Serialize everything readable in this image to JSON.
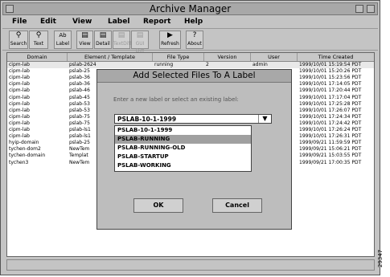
{
  "window": {
    "title": "Archive Manager"
  },
  "menu": [
    "File",
    "Edit",
    "View",
    "Label",
    "Report",
    "Help"
  ],
  "toolbar": [
    {
      "label": "Search",
      "icon": "search-icon",
      "enabled": true
    },
    {
      "label": "Text",
      "icon": "text-search-icon",
      "enabled": true
    },
    {
      "label": "Label",
      "icon": "label-icon",
      "enabled": true
    },
    {
      "label": "View",
      "icon": "view-icon",
      "enabled": true
    },
    {
      "label": "Detail",
      "icon": "detail-icon",
      "enabled": true
    },
    {
      "label": "TextDiff",
      "icon": "text-diff-icon",
      "enabled": false
    },
    {
      "label": "GUI Diff",
      "icon": "gui-diff-icon",
      "enabled": false
    },
    {
      "label": "Refresh",
      "icon": "refresh-icon",
      "enabled": true
    },
    {
      "label": "About",
      "icon": "about-icon",
      "enabled": true
    }
  ],
  "table": {
    "columns": [
      "Domain",
      "Element / Template",
      "File Type",
      "Version",
      "User",
      "Time Created"
    ],
    "rows": [
      [
        "cipm-lab",
        "pslab-2624",
        "running",
        "2",
        "admin",
        "1999/10/01 15:19:54 PDT"
      ],
      [
        "cipm-lab",
        "pslab-25",
        "",
        "",
        "",
        "1999/10/01 15:20:26 PDT"
      ],
      [
        "cipm-lab",
        "pslab-36",
        "",
        "",
        "",
        "1999/10/01 15:23:56 PDT"
      ],
      [
        "cipm-lab",
        "pslab-36",
        "",
        "",
        "",
        "1999/10/01 17:14:05 PDT"
      ],
      [
        "cipm-lab",
        "pslab-46",
        "",
        "",
        "",
        "1999/10/01 17:20:44 PDT"
      ],
      [
        "cipm-lab",
        "pslab-45",
        "",
        "",
        "",
        "1999/10/01 17:17:04 PDT"
      ],
      [
        "cipm-lab",
        "pslab-53",
        "",
        "",
        "",
        "1999/10/01 17:25:28 PDT"
      ],
      [
        "cipm-lab",
        "pslab-53",
        "",
        "",
        "",
        "1999/10/01 17:26:07 PDT"
      ],
      [
        "cipm-lab",
        "pslab-75",
        "",
        "",
        "",
        "1999/10/01 17:24:34 PDT"
      ],
      [
        "cipm-lab",
        "pslab-75",
        "",
        "",
        "",
        "1999/10/01 17:24:42 PDT"
      ],
      [
        "cipm-lab",
        "pslab-ls1",
        "",
        "",
        "",
        "1999/10/01 17:26:24 PDT"
      ],
      [
        "cipm-lab",
        "pslab-ls1",
        "",
        "",
        "",
        "1999/10/01 17:26:31 PDT"
      ],
      [
        "hyip-domain",
        "pslab-25",
        "",
        "",
        "",
        "1999/09/21 11:59:59 PDT"
      ],
      [
        "tychen-dom2",
        "NewTem",
        "",
        "",
        "",
        "1999/09/21 15:06:21 PDT"
      ],
      [
        "tychen-domain",
        "Templat",
        "",
        "",
        "",
        "1999/09/21 15:03:55 PDT"
      ],
      [
        "tychen3",
        "NewTem",
        "",
        "",
        "",
        "1999/09/21 17:00:35 PDT"
      ]
    ]
  },
  "dialog": {
    "title": "Add Selected Files To A Label",
    "prompt": "Enter a new label or select an existing label:",
    "combo_value": "PSLAB-10-1-1999",
    "options": [
      "PSLAB-10-1-1999",
      "PSLAB-RUNNING",
      "PSLAB-RUNNING-OLD",
      "PSLAB-STARTUP",
      "PSLAB-WORKING"
    ],
    "selected_option_index": 1,
    "ok_label": "OK",
    "cancel_label": "Cancel"
  },
  "side_number": "29347"
}
